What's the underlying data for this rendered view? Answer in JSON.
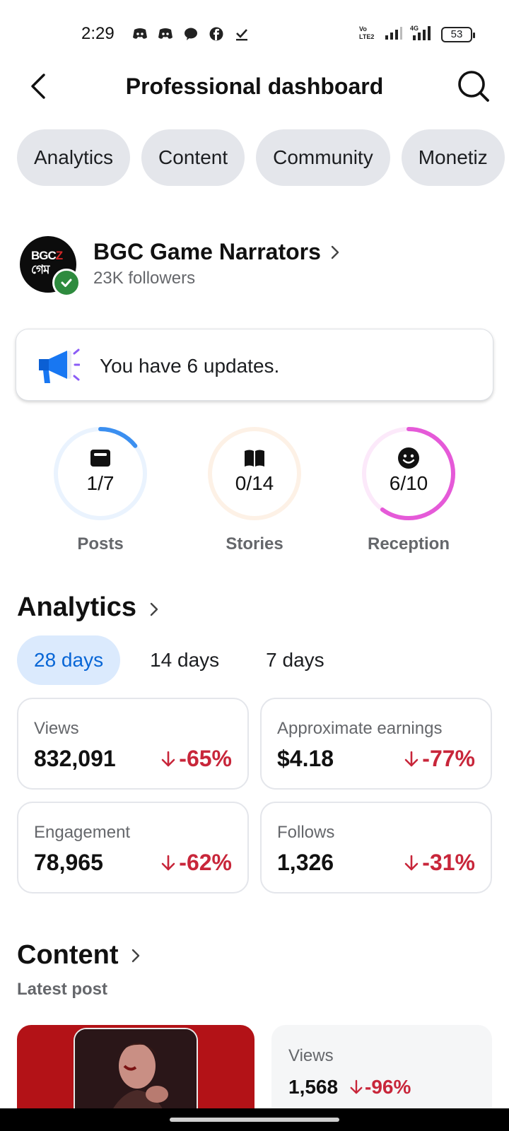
{
  "status_bar": {
    "time": "2:29",
    "notification_icons": [
      "discord-icon",
      "discord-icon",
      "chat-bubble-icon",
      "facebook-icon",
      "check-download-icon"
    ],
    "network": "VoLTE 4G",
    "battery": "53"
  },
  "header": {
    "title": "Professional dashboard"
  },
  "tabs": [
    {
      "label": "Analytics"
    },
    {
      "label": "Content"
    },
    {
      "label": "Community"
    },
    {
      "label": "Monetiz"
    }
  ],
  "profile": {
    "name": "BGC Game Narrators",
    "followers": "23K followers",
    "avatar_text_line1": "BGC",
    "avatar_text_line2": "গেম"
  },
  "updates": {
    "text": "You have 6 updates."
  },
  "progress_rings": [
    {
      "label": "Posts",
      "value": "1/7",
      "fraction": 0.1429,
      "color": "#3b8ff0",
      "track": "#eaf3fe",
      "icon": "post-icon"
    },
    {
      "label": "Stories",
      "value": "0/14",
      "fraction": 0.0,
      "color": "#f4a261",
      "track": "#fdf1e6",
      "icon": "book-icon"
    },
    {
      "label": "Reception",
      "value": "6/10",
      "fraction": 0.6,
      "color": "#e55ad8",
      "track": "#fce9fa",
      "icon": "smiley-icon"
    }
  ],
  "analytics": {
    "title": "Analytics",
    "ranges": [
      {
        "label": "28 days",
        "active": true
      },
      {
        "label": "14 days",
        "active": false
      },
      {
        "label": "7 days",
        "active": false
      }
    ],
    "metrics": [
      {
        "label": "Views",
        "value": "832,091",
        "change": "-65%"
      },
      {
        "label": "Approximate earnings",
        "value": "$4.18",
        "change": "-77%"
      },
      {
        "label": "Engagement",
        "value": "78,965",
        "change": "-62%"
      },
      {
        "label": "Follows",
        "value": "1,326",
        "change": "-31%"
      }
    ]
  },
  "content": {
    "title": "Content",
    "latest_label": "Latest post",
    "latest_post": {
      "stat_label": "Views",
      "stat_value": "1,568",
      "stat_change": "-96%"
    }
  },
  "colors": {
    "accent": "#0866d6",
    "negative": "#c8263a",
    "verified": "#2e8b3e"
  }
}
